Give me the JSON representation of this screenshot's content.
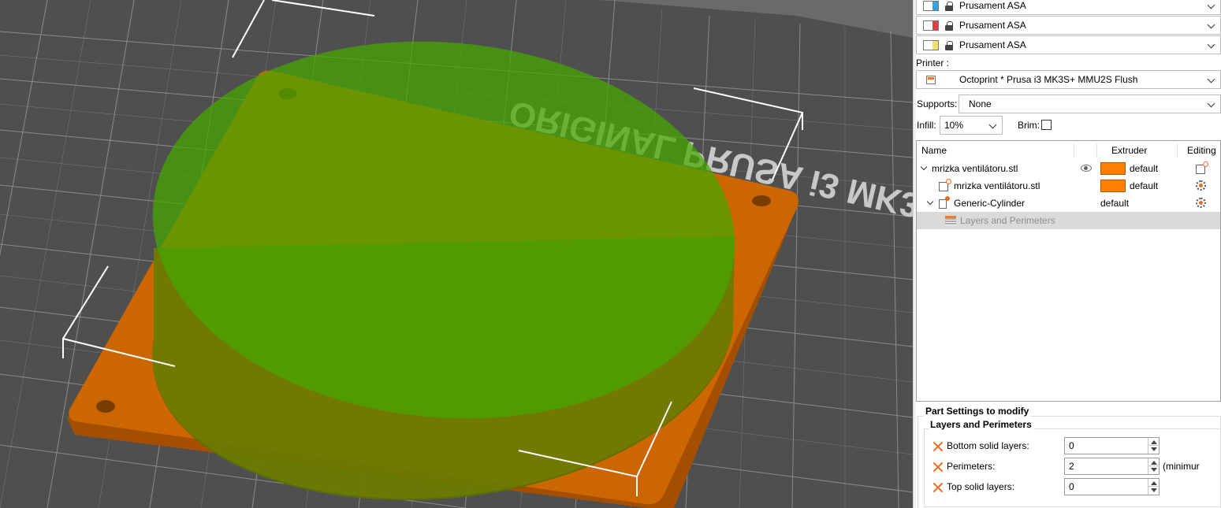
{
  "filaments": [
    {
      "label": "Prusament ASA",
      "color": "#3aa0e0"
    },
    {
      "label": "Prusament ASA",
      "color": "#e04040"
    },
    {
      "label": "Prusament ASA",
      "color": "#f0e070"
    }
  ],
  "printer": {
    "label": "Printer :",
    "value": "Octoprint * Prusa i3 MK3S+ MMU2S Flush"
  },
  "supports": {
    "label": "Supports:",
    "value": "None"
  },
  "infill": {
    "label": "Infill:",
    "value": "10%"
  },
  "brim": {
    "label": "Brim:",
    "checked": false
  },
  "object_list": {
    "columns": {
      "name": "Name",
      "extruder": "Extruder",
      "editing": "Editing"
    },
    "rows": [
      {
        "name": "mrizka ventilátoru.stl",
        "extruder": "default",
        "extruder_color": "#ff8000"
      },
      {
        "name": "mrizka ventilátoru.stl",
        "extruder": "default",
        "extruder_color": "#ff8000"
      },
      {
        "name": "Generic-Cylinder",
        "extruder": "default"
      },
      {
        "name": "Layers and Perimeters"
      }
    ]
  },
  "part_settings": {
    "title": "Part Settings to modify",
    "group": "Layers and Perimeters",
    "fields": [
      {
        "label": "Bottom solid layers:",
        "value": "0"
      },
      {
        "label": "Perimeters:",
        "value": "2",
        "suffix": "(minimur"
      },
      {
        "label": "Top solid layers:",
        "value": "0"
      }
    ]
  },
  "scene": {
    "bed_text": "ORIGINAL PRUSA i3 MK3",
    "bed_color": "#4f4f4f",
    "part_color": "#cc6600",
    "modifier_color": "#5fa800"
  }
}
